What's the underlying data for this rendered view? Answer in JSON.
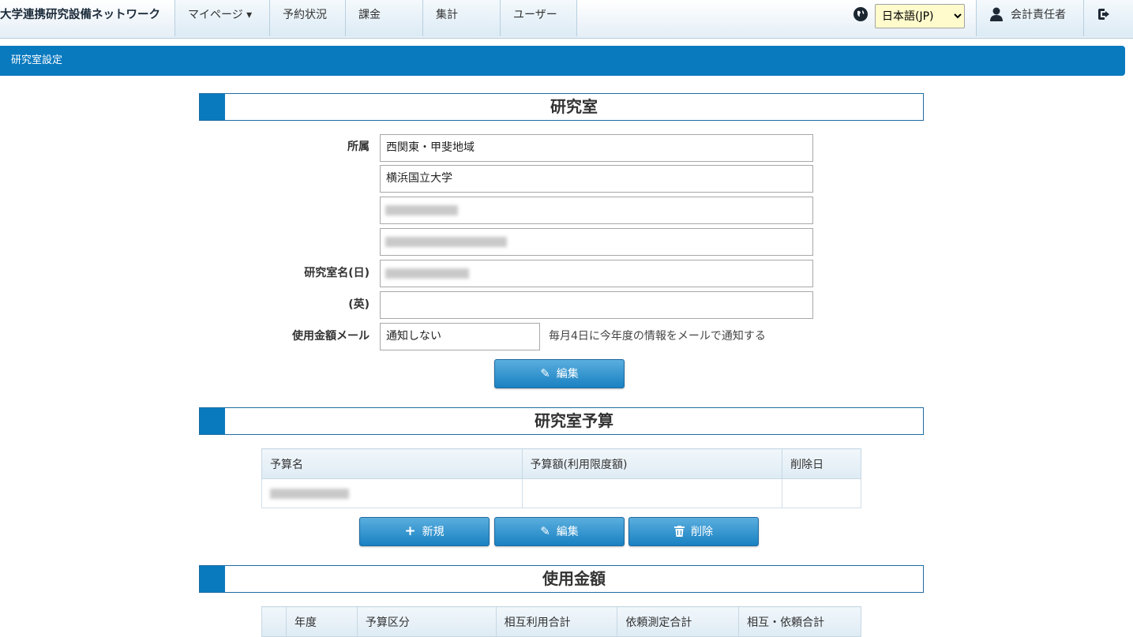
{
  "nav": {
    "brand": "大学連携研究設備ネットワーク",
    "tabs": [
      "マイページ ▾",
      "予約状況",
      "課金",
      "集計",
      "ユーザー"
    ],
    "language": "日本語(JP)",
    "language_options": [
      "日本語(JP)"
    ],
    "user_label": "会計責任者"
  },
  "page": {
    "header": "研究室設定"
  },
  "lab": {
    "title": "研究室",
    "affiliation_label": "所属",
    "affiliation": [
      "西関東・甲斐地域",
      "横浜国立大学"
    ],
    "name_ja_label": "研究室名(日)",
    "name_en_label": "(英)",
    "name_en": "",
    "mail_label": "使用金額メール",
    "mail_value": "通知しない",
    "mail_note": "毎月4日に今年度の情報をメールで通知する",
    "edit_button": "編集"
  },
  "budget": {
    "title": "研究室予算",
    "columns": [
      "予算名",
      "予算額(利用限度額)",
      "削除日"
    ],
    "rows": [
      [
        "",
        "",
        ""
      ]
    ],
    "new_button": "新規",
    "edit_button": "編集",
    "delete_button": "削除"
  },
  "usage": {
    "title": "使用金額",
    "columns": [
      "",
      "年度",
      "予算区分",
      "相互利用合計",
      "依頼測定合計",
      "相互・依頼合計"
    ]
  },
  "colors": {
    "accent": "#0a7abf",
    "button": "#1981c2"
  },
  "icons": {
    "globe": "globe-icon",
    "user": "user-icon",
    "logout": "logout-icon",
    "pencil": "pencil-icon",
    "plus": "plus-icon",
    "trash": "trash-icon"
  }
}
